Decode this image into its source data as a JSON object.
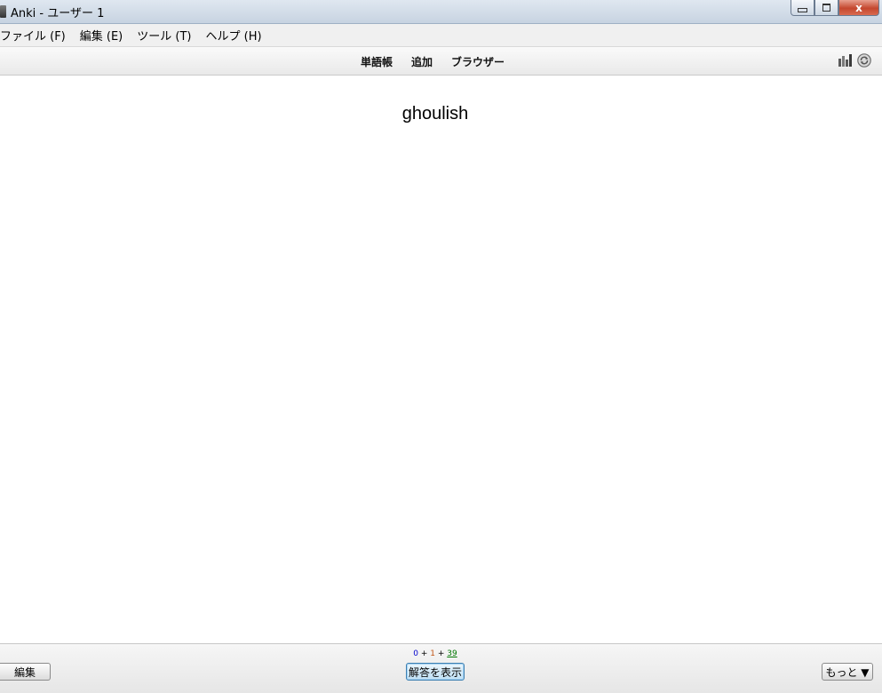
{
  "window": {
    "title": "Anki - ユーザー 1",
    "controls": {
      "minimize": "",
      "maximize": "",
      "close": "x"
    }
  },
  "menu": [
    {
      "label": "ファイル (F)"
    },
    {
      "label": "編集 (E)"
    },
    {
      "label": "ツール (T)"
    },
    {
      "label": "ヘルプ (H)"
    }
  ],
  "toolbar": {
    "links": [
      {
        "label": "単語帳"
      },
      {
        "label": "追加"
      },
      {
        "label": "ブラウザー"
      }
    ],
    "icons": [
      "stats-icon",
      "sync-icon"
    ]
  },
  "card": {
    "front": "ghoulish"
  },
  "bottom": {
    "counts": {
      "new": "0",
      "sep1": " + ",
      "learn": "1",
      "sep2": " + ",
      "review": "39"
    },
    "edit_label": "編集",
    "show_answer_label": "解答を表示",
    "more_label": "もっと ▼"
  },
  "colors": {
    "new": "#0000cc",
    "learning": "#c35617",
    "review": "#007700"
  }
}
